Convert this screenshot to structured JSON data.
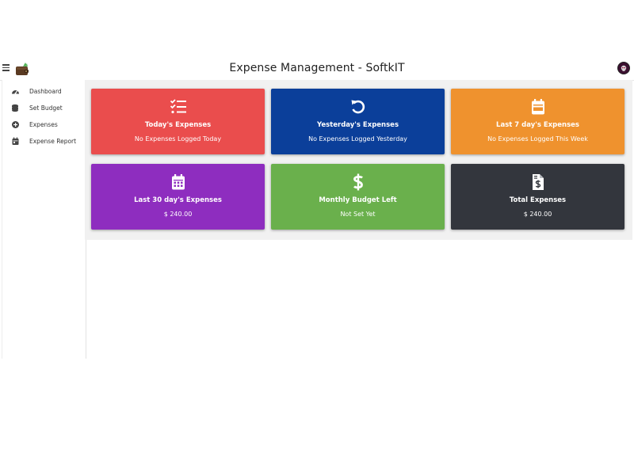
{
  "header": {
    "title": "Expense Management - SoftkIT"
  },
  "sidebar": {
    "items": [
      {
        "label": "Dashboard",
        "icon": "dashboard-icon"
      },
      {
        "label": "Set Budget",
        "icon": "coins-icon"
      },
      {
        "label": "Expenses",
        "icon": "plus-circle-icon"
      },
      {
        "label": "Expense Report",
        "icon": "calendar-icon"
      }
    ]
  },
  "cards": [
    {
      "title": "Today's Expenses",
      "value": "No Expenses Logged Today",
      "color": "#ea4d4d",
      "icon": "checklist-icon"
    },
    {
      "title": "Yesterday's Expenses",
      "value": "No Expenses Logged Yesterday",
      "color": "#0b3f9a",
      "icon": "undo-icon"
    },
    {
      "title": "Last 7 day's Expenses",
      "value": "No Expenses Logged This Week",
      "color": "#ef922e",
      "icon": "calendar-week-icon"
    },
    {
      "title": "Last 30 day's Expenses",
      "value": "$ 240.00",
      "color": "#8e2dbf",
      "icon": "calendar-month-icon"
    },
    {
      "title": "Monthly Budget Left",
      "value": "Not Set Yet",
      "color": "#6ab04c",
      "icon": "dollar-icon"
    },
    {
      "title": "Total Expenses",
      "value": "$ 240.00",
      "color": "#33363d",
      "icon": "invoice-icon"
    }
  ]
}
